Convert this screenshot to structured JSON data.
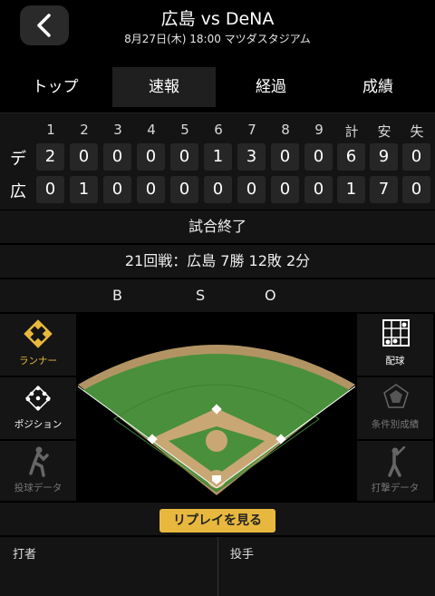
{
  "header": {
    "title": "広島 vs DeNA",
    "subtitle": "8月27日(木) 18:00 マツダスタジアム"
  },
  "tabs": [
    {
      "label": "トップ",
      "active": false
    },
    {
      "label": "速報",
      "active": true
    },
    {
      "label": "経過",
      "active": false
    },
    {
      "label": "成績",
      "active": false
    }
  ],
  "scoreboard": {
    "columns": [
      "1",
      "2",
      "3",
      "4",
      "5",
      "6",
      "7",
      "8",
      "9",
      "計",
      "安",
      "失"
    ],
    "rows": [
      {
        "team": "デ",
        "values": [
          "2",
          "0",
          "0",
          "0",
          "0",
          "1",
          "3",
          "0",
          "0",
          "6",
          "9",
          "0"
        ]
      },
      {
        "team": "広",
        "values": [
          "0",
          "1",
          "0",
          "0",
          "0",
          "0",
          "0",
          "0",
          "0",
          "1",
          "7",
          "0"
        ]
      }
    ]
  },
  "status": "試合終了",
  "series": "21回戦：広島 7勝 12敗 2分",
  "bso": {
    "b": "B",
    "s": "S",
    "o": "O"
  },
  "left_panel": [
    {
      "label": "ランナー",
      "icon": "runner-diamond-icon",
      "active": true
    },
    {
      "label": "ポジション",
      "icon": "position-diamond-icon",
      "active": false
    },
    {
      "label": "投球データ",
      "icon": "pitcher-icon",
      "active": false
    }
  ],
  "right_panel": [
    {
      "label": "配球",
      "icon": "pitch-grid-icon",
      "active": false
    },
    {
      "label": "条件別成績",
      "icon": "radar-chart-icon",
      "active": false
    },
    {
      "label": "打撃データ",
      "icon": "batter-icon",
      "active": false
    }
  ],
  "replay_label": "リプレイを見る",
  "bottom": {
    "batter": "打者",
    "pitcher": "投手"
  },
  "colors": {
    "accent": "#e8b83e",
    "grass": "#4a8f3c",
    "dirt": "#c9a775"
  }
}
